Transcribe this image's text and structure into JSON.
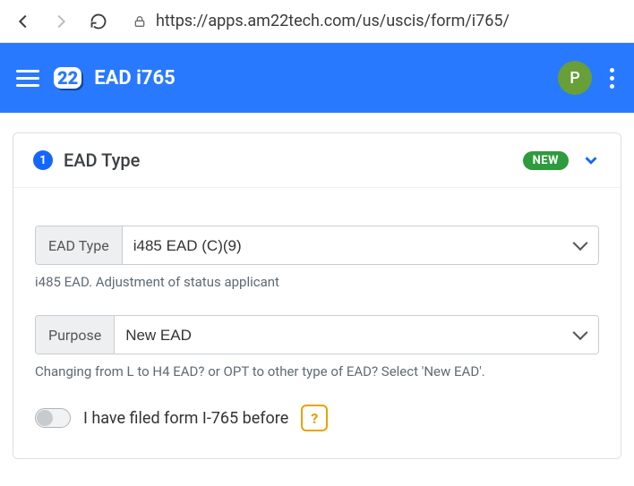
{
  "browser": {
    "url": "https://apps.am22tech.com/us/uscis/form/i765/"
  },
  "header": {
    "logo_text": "22",
    "title": "EAD i765",
    "avatar_initial": "P"
  },
  "card": {
    "step_number": "1",
    "title": "EAD Type",
    "badge": "NEW"
  },
  "fields": {
    "ead_type": {
      "label": "EAD Type",
      "value": "i485 EAD (C)(9)",
      "helper": "i485 EAD. Adjustment of status applicant"
    },
    "purpose": {
      "label": "Purpose",
      "value": "New EAD",
      "helper": "Changing from L to H4 EAD? or OPT to other type of EAD? Select 'New EAD'."
    },
    "filed_before": {
      "label": "I have filed form I-765 before",
      "help_symbol": "?"
    }
  }
}
